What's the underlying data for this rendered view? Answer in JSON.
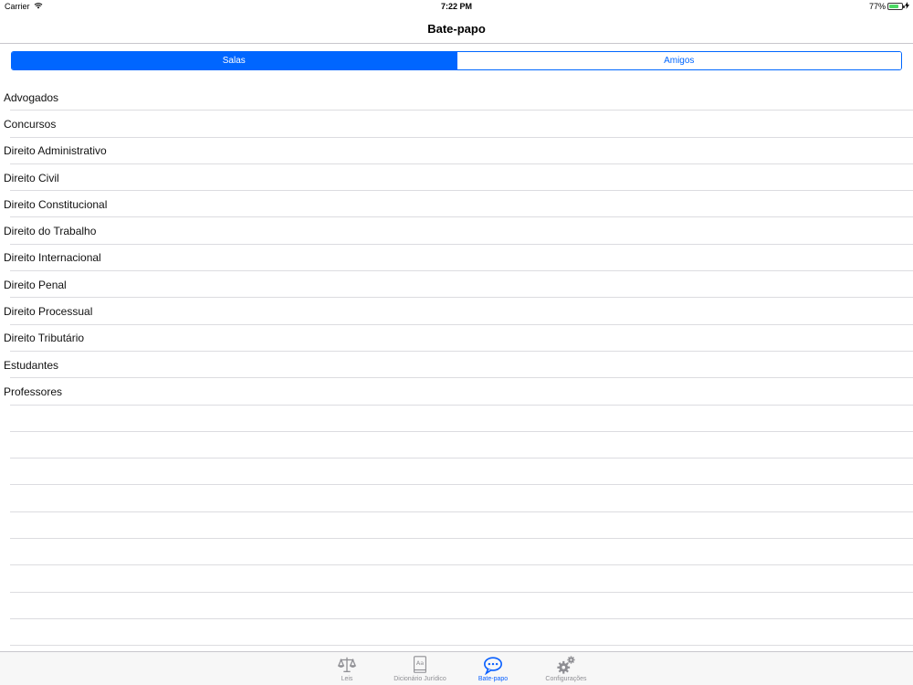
{
  "status_bar": {
    "carrier": "Carrier",
    "time": "7:22 PM",
    "battery_text": "77%",
    "battery_level": 0.77
  },
  "nav": {
    "title": "Bate-papo"
  },
  "segments": [
    {
      "label": "Salas",
      "selected": true
    },
    {
      "label": "Amigos",
      "selected": false
    }
  ],
  "rooms": [
    "Advogados",
    "Concursos",
    "Direito Administrativo",
    "Direito Civil",
    "Direito Constitucional",
    "Direito do Trabalho",
    "Direito Internacional",
    "Direito Penal",
    "Direito Processual",
    "Direito Tributário",
    "Estudantes",
    "Professores"
  ],
  "tabs": [
    {
      "label": "Leis",
      "icon": "scales-icon",
      "active": false
    },
    {
      "label": "Dicionário Jurídico",
      "icon": "dictionary-icon",
      "active": false
    },
    {
      "label": "Bate-papo",
      "icon": "chat-bubble-icon",
      "active": true
    },
    {
      "label": "Configurações",
      "icon": "gears-icon",
      "active": false
    }
  ],
  "colors": {
    "accent": "#0066ff",
    "battery": "#4cd964",
    "inactive_tab": "#8e8e93"
  }
}
